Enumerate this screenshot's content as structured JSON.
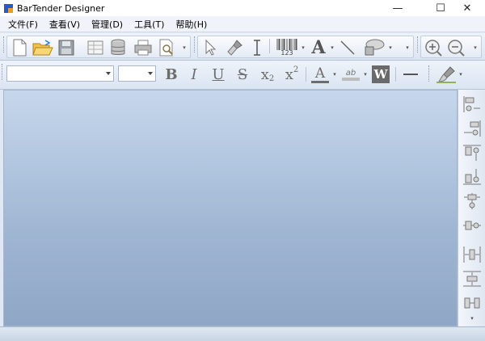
{
  "window": {
    "title": "BarTender Designer",
    "controls": {
      "minimize": "—",
      "maximize": "☐",
      "close": "✕"
    }
  },
  "menu": {
    "items": [
      {
        "label": "文件(F)"
      },
      {
        "label": "查看(V)"
      },
      {
        "label": "管理(D)"
      },
      {
        "label": "工具(T)"
      },
      {
        "label": "帮助(H)"
      }
    ]
  },
  "toolbar_main": {
    "barcode_caption": "123",
    "text_tool": "A"
  },
  "toolbar_format": {
    "font_name": "",
    "font_size": "",
    "bold": "B",
    "italic": "I",
    "underline": "U",
    "strike": "S",
    "subscript": "x",
    "subscript_mark": "2",
    "superscript": "x",
    "superscript_mark": "2",
    "font_color": "A",
    "highlight": "ab",
    "word_wrap": "W"
  },
  "colors": {
    "canvas_top": "#c6d7ec",
    "canvas_bottom": "#8fa6c5",
    "accent": "#1f5fbf",
    "logo_orange": "#f29b1d"
  }
}
